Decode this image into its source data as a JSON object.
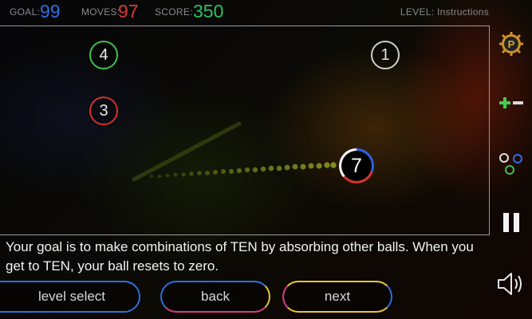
{
  "hud": {
    "goal_label": "GOAL:",
    "goal_value": "99",
    "moves_label": "MOVES:",
    "moves_value": "97",
    "score_label": "SCORE:",
    "score_value": "350",
    "level_text": "LEVEL: Instructions"
  },
  "balls": [
    {
      "number": "4",
      "color": "#3fc04d"
    },
    {
      "number": "1",
      "color": "#cfcfcf"
    },
    {
      "number": "3",
      "color": "#d3302c"
    },
    {
      "number": "7",
      "colors": [
        "#2d5fe0",
        "#d8332b",
        "#ffffff"
      ]
    }
  ],
  "instructions": {
    "text": "Your goal is to make combinations of TEN by absorbing other balls. When you get to TEN, your ball resets to zero."
  },
  "buttons": {
    "level_select": "level select",
    "back": "back",
    "next": "next"
  },
  "sidebar": {
    "powerup_letter": "P",
    "icons": [
      "powerup-icon",
      "plus-minus-icon",
      "balls-icon",
      "pause-icon",
      "sound-icon"
    ]
  },
  "colors": {
    "goal": "#2f6ee0",
    "moves": "#d93a33",
    "score": "#2fc25a",
    "accent_blue": "#2d6ee0",
    "accent_yellow": "#e6c53a",
    "accent_pink": "#d83a8a"
  }
}
